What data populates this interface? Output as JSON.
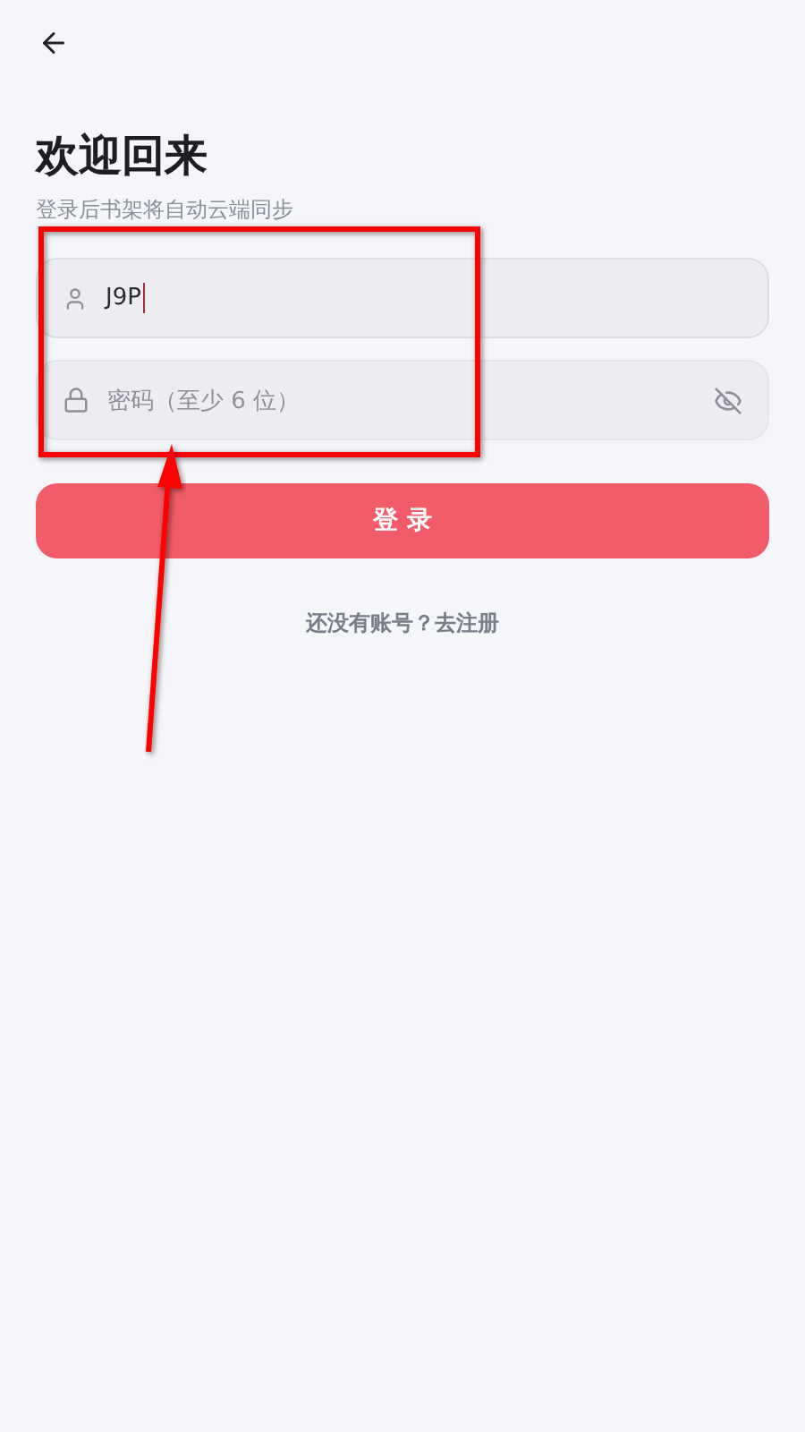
{
  "title": "欢迎回来",
  "subtitle": "登录后书架将自动云端同步",
  "username": {
    "value": "J9P",
    "focused": true
  },
  "password": {
    "placeholder": "密码（至少 6 位）",
    "password_visible": false
  },
  "login_button": "登 录",
  "register_link": "还没有账号？去注册"
}
